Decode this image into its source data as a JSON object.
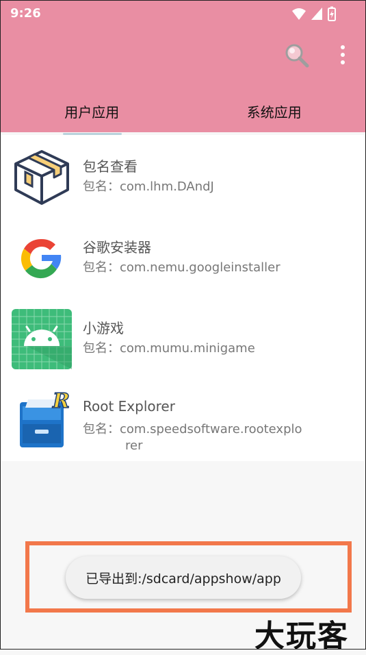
{
  "status_bar": {
    "time": "9:26"
  },
  "tabs": [
    {
      "label": "用户应用",
      "selected": true
    },
    {
      "label": "系统应用",
      "selected": false
    }
  ],
  "apps": [
    {
      "name": "包名查看",
      "pkg_prefix": "包名：",
      "pkg_line1": "com.lhm.DAndJ",
      "pkg_line2": "",
      "icon": "package-box-icon"
    },
    {
      "name": "谷歌安装器",
      "pkg_prefix": "包名：",
      "pkg_line1": "com.nemu.googleinstaller",
      "pkg_line2": "",
      "icon": "google-g-icon"
    },
    {
      "name": "小游戏",
      "pkg_prefix": "包名：",
      "pkg_line1": "com.mumu.minigame",
      "pkg_line2": "",
      "icon": "android-robot-icon"
    },
    {
      "name": "Root Explorer",
      "pkg_prefix": "包名：",
      "pkg_line1": "com.speedsoftware.rootexplo",
      "pkg_line2": "rer",
      "icon": "file-cabinet-icon"
    }
  ],
  "toast": {
    "text": "已导出到:/sdcard/appshow/app"
  },
  "watermark": {
    "text": "大玩客"
  },
  "colors": {
    "appbar": "#e98ea3",
    "highlight_border": "#f2784b",
    "tab_indicator": "#b9d2dc"
  }
}
